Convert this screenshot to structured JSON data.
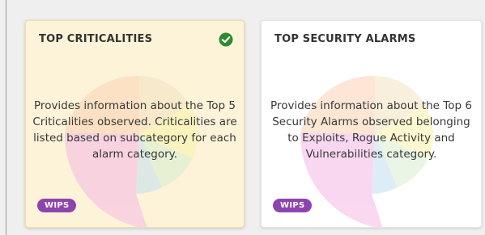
{
  "cards": [
    {
      "title": "TOP CRITICALITIES",
      "description": "Provides information about the Top 5 Criticalities observed. Criticalities are listed based on subcategory for each alarm category.",
      "badge": "WIPS",
      "selected": true,
      "status_icon": "check-circle-icon"
    },
    {
      "title": "TOP SECURITY ALARMS",
      "description": "Provides information about the Top 6 Security Alarms observed belonging to Exploits, Rogue Activity and Vulnerabilities category.",
      "badge": "WIPS",
      "selected": false
    }
  ],
  "colors": {
    "selected_card_bg": "#fcf3d9",
    "card_bg": "#ffffff",
    "badge_bg": "#8e44ad",
    "check_green": "#2e8b2e"
  }
}
